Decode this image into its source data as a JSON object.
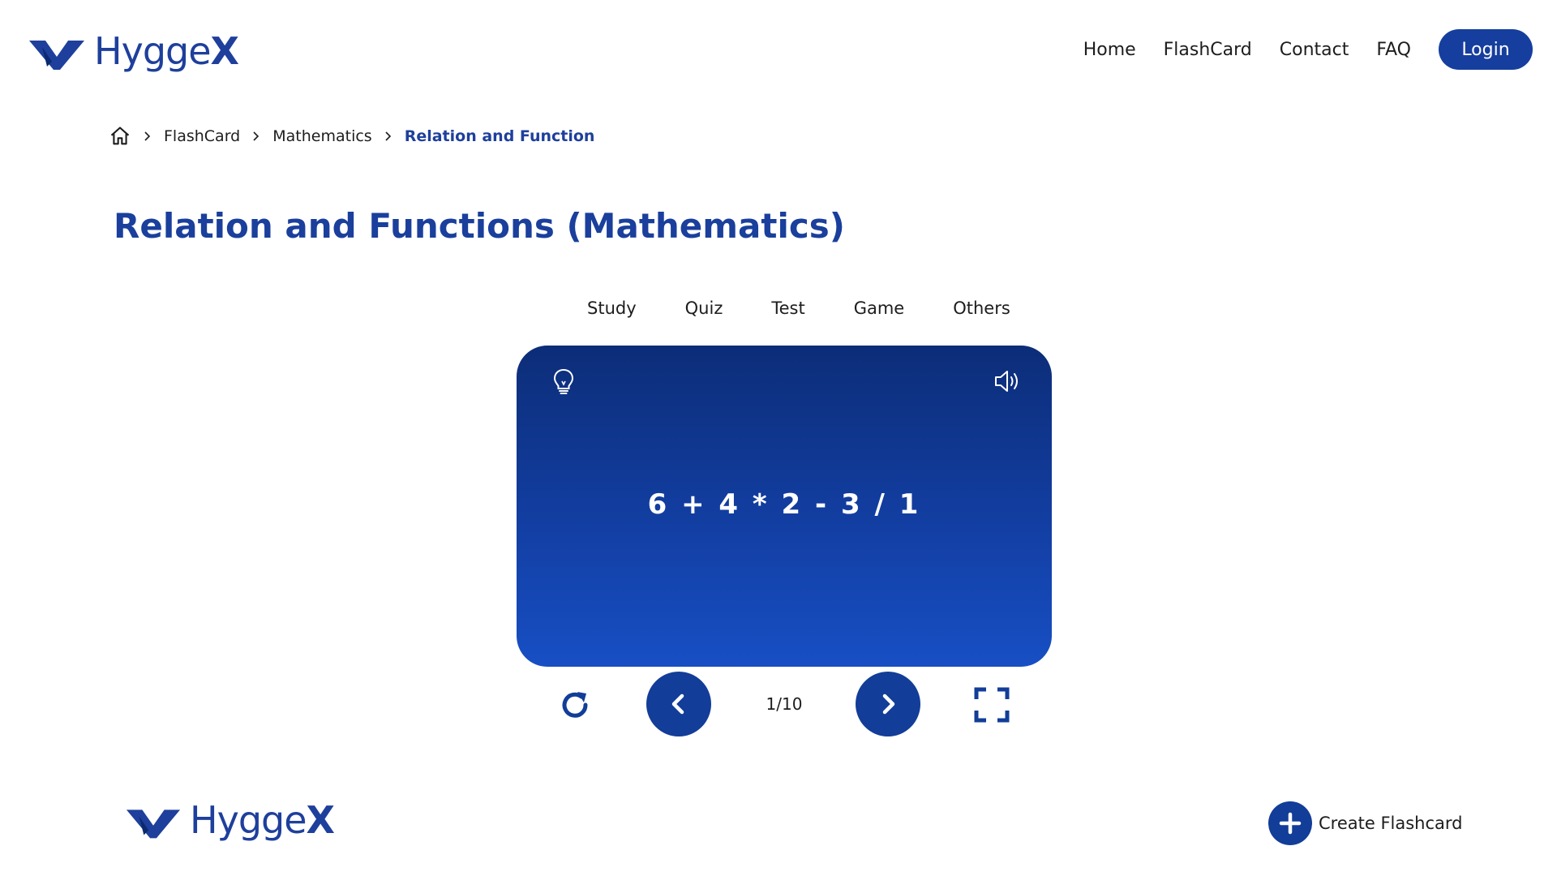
{
  "brand": {
    "name_light": "Hygge",
    "name_bold": "X",
    "color": "#1e3f9c"
  },
  "nav": {
    "items": [
      "Home",
      "FlashCard",
      "Contact",
      "FAQ"
    ],
    "login_label": "Login"
  },
  "breadcrumb": {
    "home_icon": "home-icon",
    "items": [
      "FlashCard",
      "Mathematics"
    ],
    "current": "Relation and Function"
  },
  "page_title": "Relation and Functions (Mathematics)",
  "tabs": [
    "Study",
    "Quiz",
    "Test",
    "Game",
    "Others"
  ],
  "card": {
    "text": "6 + 4 * 2 - 3 / 1",
    "hint_icon": "lightbulb-icon",
    "sound_icon": "speaker-icon",
    "gradient_top": "#0c2d78",
    "gradient_bottom": "#174fc4"
  },
  "controls": {
    "counter": "1/10",
    "reset_icon": "refresh-icon",
    "prev_icon": "chevron-left-icon",
    "next_icon": "chevron-right-icon",
    "fullscreen_icon": "fullscreen-icon"
  },
  "footer": {
    "create_label": "Create Flashcard",
    "create_icon": "plus-icon"
  },
  "colors": {
    "accent": "#123d98",
    "title": "#1a3f9c"
  }
}
